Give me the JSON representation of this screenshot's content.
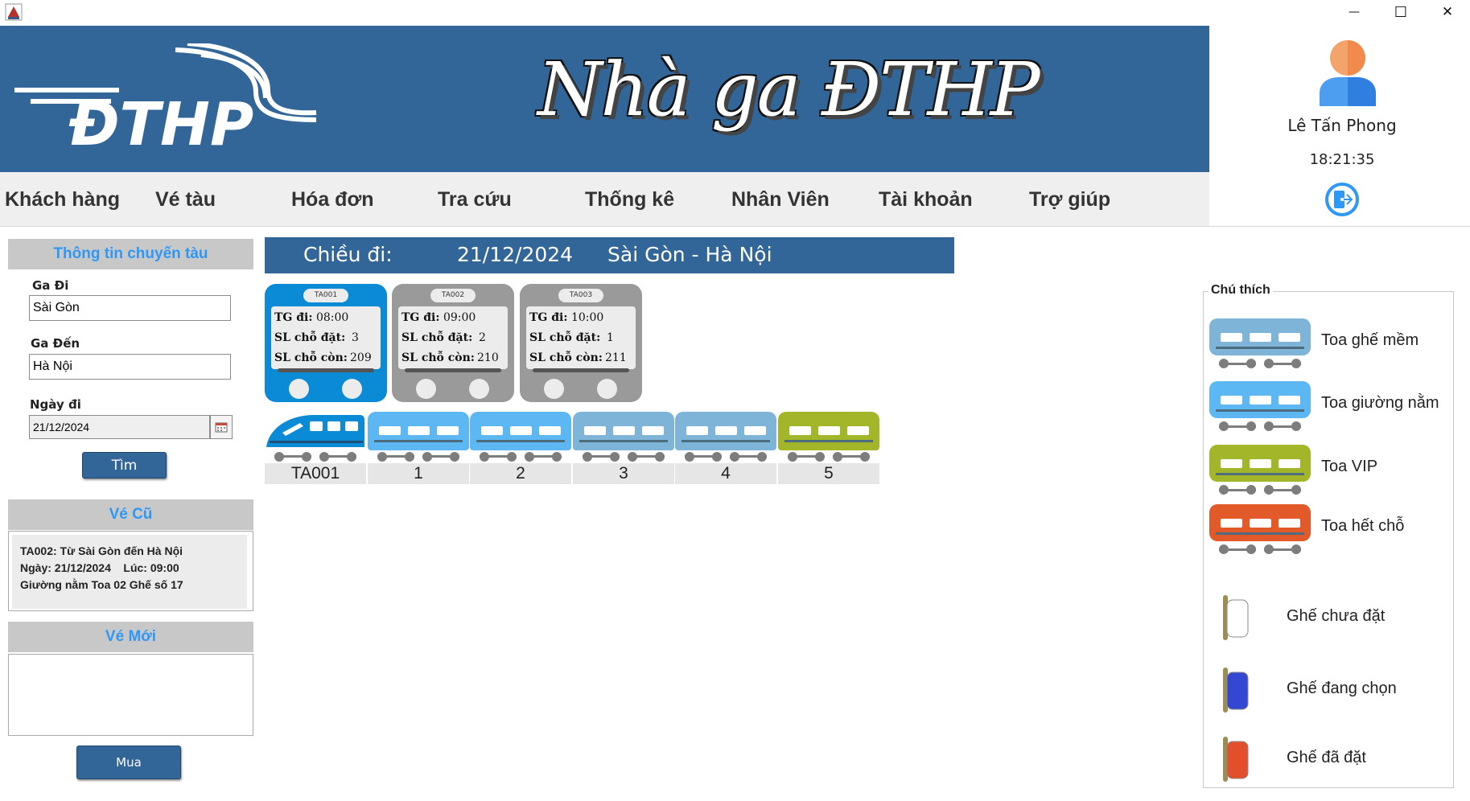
{
  "window": {
    "minimize_glyph": "—",
    "maximize_glyph": "☐",
    "close_glyph": "✕"
  },
  "header": {
    "logo_text": "ĐTHP",
    "title": "Nhà ga ĐTHP"
  },
  "user": {
    "name": "Lê Tấn Phong",
    "time": "18:21:35"
  },
  "menu": [
    "Khách hàng",
    "Vé tàu",
    "Hóa đơn",
    "Tra cứu",
    "Thống kê",
    "Nhân Viên",
    "Tài khoản",
    "Trợ giúp"
  ],
  "search": {
    "section_title": "Thông tin chuyến tàu",
    "from_label": "Ga Đi",
    "from_value": "Sài Gòn",
    "to_label": "Ga Đến",
    "to_value": "Hà Nội",
    "date_label": "Ngày đi",
    "date_value": "21/12/2024",
    "search_button": "Tìm"
  },
  "old_ticket": {
    "title": "Vé Cũ",
    "line1": "TA002: Từ Sài Gòn đến Hà Nội",
    "line2": "Ngày: 21/12/2024    Lúc: 09:00",
    "line3": "Giường nằm Toa 02 Ghế số 17"
  },
  "new_ticket": {
    "title": "Vé Mới",
    "buy_button": "Mua"
  },
  "trip": {
    "direction_label": "Chiều đi:",
    "date": "21/12/2024",
    "route": "Sài Gòn - Hà Nội"
  },
  "trains": [
    {
      "code": "TA001",
      "time_label": "TG đi:",
      "time": "08:00",
      "booked_label": "SL chỗ đặt:",
      "booked": "3",
      "remaining_label": "SL chỗ còn:",
      "remaining": "209",
      "selected": true
    },
    {
      "code": "TA002",
      "time_label": "TG đi:",
      "time": "09:00",
      "booked_label": "SL chỗ đặt:",
      "booked": "2",
      "remaining_label": "SL chỗ còn:",
      "remaining": "210",
      "selected": false
    },
    {
      "code": "TA003",
      "time_label": "TG đi:",
      "time": "10:00",
      "booked_label": "SL chỗ đặt:",
      "booked": "1",
      "remaining_label": "SL chỗ còn:",
      "remaining": "211",
      "selected": false
    }
  ],
  "coaches": [
    {
      "label": "TA001",
      "type": "locomotive",
      "color": "#0b8ad6"
    },
    {
      "label": "1",
      "type": "giường nằm",
      "color": "#5cb7f2"
    },
    {
      "label": "2",
      "type": "giường nằm",
      "color": "#5cb7f2"
    },
    {
      "label": "3",
      "type": "ghế mềm",
      "color": "#7fb4d9"
    },
    {
      "label": "4",
      "type": "ghế mềm",
      "color": "#7fb4d9"
    },
    {
      "label": "5",
      "type": "VIP",
      "color": "#a3b629"
    }
  ],
  "legend": {
    "title": "Chú thích",
    "coach_types": [
      {
        "label": "Toa ghế mềm",
        "color": "#7fb4d9"
      },
      {
        "label": "Toa giường nằm",
        "color": "#5cb7f2"
      },
      {
        "label": "Toa VIP",
        "color": "#a3b629"
      },
      {
        "label": "Toa hết chỗ",
        "color": "#e35a2a"
      }
    ],
    "seat_types": [
      {
        "label": "Ghế chưa đặt",
        "color": "#ffffff"
      },
      {
        "label": "Ghế đang chọn",
        "color": "#3347d3"
      },
      {
        "label": "Ghế đã đặt",
        "color": "#e34f2b"
      }
    ]
  },
  "colors": {
    "primary": "#326699",
    "accent": "#2f97f4",
    "card_selected": "#0b8ad6",
    "card_default": "#9a9a9a"
  }
}
